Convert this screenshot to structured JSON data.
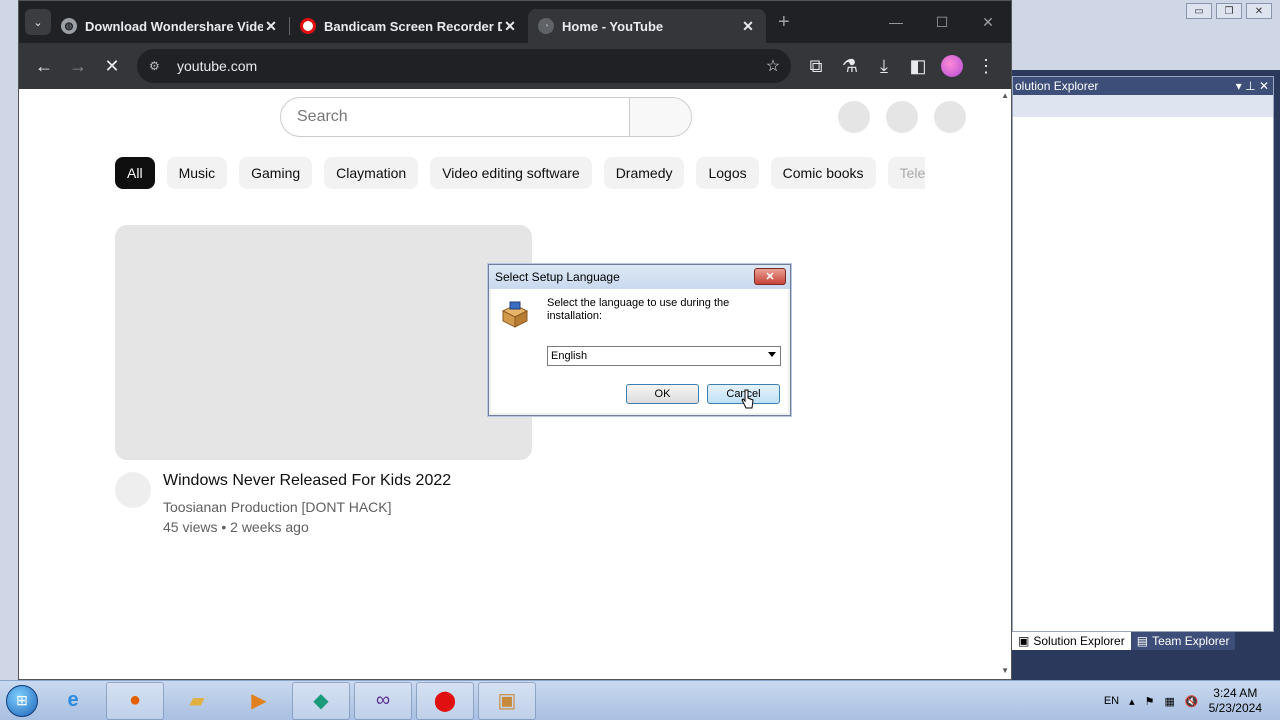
{
  "browser": {
    "tabs": [
      {
        "title": "Download Wondershare Video",
        "favicon": "globe-icon",
        "active": false
      },
      {
        "title": "Bandicam Screen Recorder Do",
        "favicon": "record-icon",
        "active": false
      },
      {
        "title": "Home - YouTube",
        "favicon": "youtube-icon",
        "active": true
      }
    ],
    "address": "youtube.com"
  },
  "youtube": {
    "search_placeholder": "Search",
    "chips": [
      "All",
      "Music",
      "Gaming",
      "Claymation",
      "Video editing software",
      "Dramedy",
      "Logos",
      "Comic books",
      "Tele"
    ],
    "video": {
      "title": "Windows Never Released For Kids 2022",
      "channel": "Toosianan Production [DONT HACK]",
      "meta": "45 views • 2 weeks ago"
    }
  },
  "dialog": {
    "title": "Select Setup Language",
    "message": "Select the language to use during the installation:",
    "language": "English",
    "ok_label": "OK",
    "cancel_label": "Cancel",
    "close_glyph": "✕"
  },
  "vs": {
    "panel_title": "olution Explorer",
    "tab_solution": "Solution Explorer",
    "tab_team": "Team Explorer"
  },
  "taskbar": {
    "language": "EN",
    "time": "3:24 AM",
    "date": "5/23/2024"
  },
  "colors": {
    "dialog_close": "#c7453a",
    "chip_active": "#0f0f0f",
    "record_red": "#e01010"
  }
}
